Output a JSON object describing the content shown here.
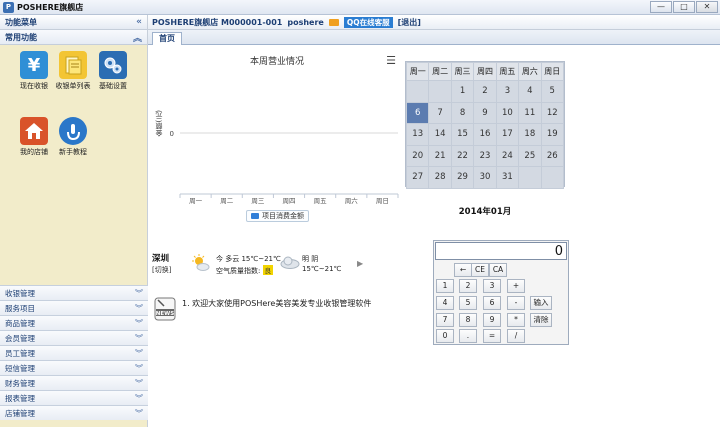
{
  "window": {
    "title": "POSHERE旗舰店",
    "icon": "app-logo-icon",
    "min": "—",
    "max": "□",
    "close": "✕"
  },
  "sidebar": {
    "header": "功能菜单",
    "section": "常用功能",
    "tiles": [
      {
        "label": "现在收银",
        "icon": "yen-icon",
        "color": "#2f8fd6"
      },
      {
        "label": "收银单列表",
        "icon": "notes-icon",
        "color": "#f3c534"
      },
      {
        "label": "基础设置",
        "icon": "gears-icon",
        "color": "#2b6db3"
      },
      {
        "label": "我的店铺",
        "icon": "house-icon",
        "color": "#d9532a"
      },
      {
        "label": "新手教程",
        "icon": "touch-icon",
        "color": "#2a77c9"
      }
    ],
    "menu": [
      "收银管理",
      "服务项目",
      "商品管理",
      "会员管理",
      "员工管理",
      "短信管理",
      "财务管理",
      "报表管理",
      "店铺管理"
    ]
  },
  "topbar": {
    "store": "POSHERE旗舰店 M000001-001",
    "user": "poshere",
    "qq": "QQ在线客服",
    "logout": "[退出]"
  },
  "tabs": [
    "首页"
  ],
  "chart_data": {
    "type": "bar",
    "title": "本周营业情况",
    "ylabel": "金额(元)",
    "categories": [
      "周一",
      "周二",
      "周三",
      "周四",
      "周五",
      "周六",
      "周日"
    ],
    "series": [
      {
        "name": "项目消费金额",
        "values": [
          0,
          0,
          0,
          0,
          0,
          0,
          0
        ],
        "color": "#2f7ed8"
      }
    ],
    "yticks": [
      "0"
    ]
  },
  "weather": {
    "city": "深圳",
    "switch": "[切换]",
    "today": "今 多云 15℃~21℃",
    "aq_label": "空气质量指数:",
    "aq_value": "良",
    "tomorrow": "明 阴",
    "tomorrow_temp": "15℃~21℃"
  },
  "news": {
    "item": "1. 欢迎大家使用POSHere美容美发专业收银管理软件",
    "icon": "news-icon"
  },
  "calendar": {
    "weekdays": [
      "周一",
      "周二",
      "周三",
      "周四",
      "周五",
      "周六",
      "周日"
    ],
    "weeks": [
      [
        "",
        "",
        "1",
        "2",
        "3",
        "4",
        "5"
      ],
      [
        "6",
        "7",
        "8",
        "9",
        "10",
        "11",
        "12"
      ],
      [
        "13",
        "14",
        "15",
        "16",
        "17",
        "18",
        "19"
      ],
      [
        "20",
        "21",
        "22",
        "23",
        "24",
        "25",
        "26"
      ],
      [
        "27",
        "28",
        "29",
        "30",
        "31",
        "",
        ""
      ]
    ],
    "today": "6",
    "month_label": "2014年01月"
  },
  "calculator": {
    "display": "0",
    "keys": [
      "←",
      "CE",
      "CA",
      "1",
      "2",
      "3",
      "+",
      "4",
      "5",
      "6",
      "-",
      "7",
      "8",
      "9",
      "*",
      "0",
      ".",
      "=",
      "/",
      "输入",
      "清除"
    ]
  }
}
